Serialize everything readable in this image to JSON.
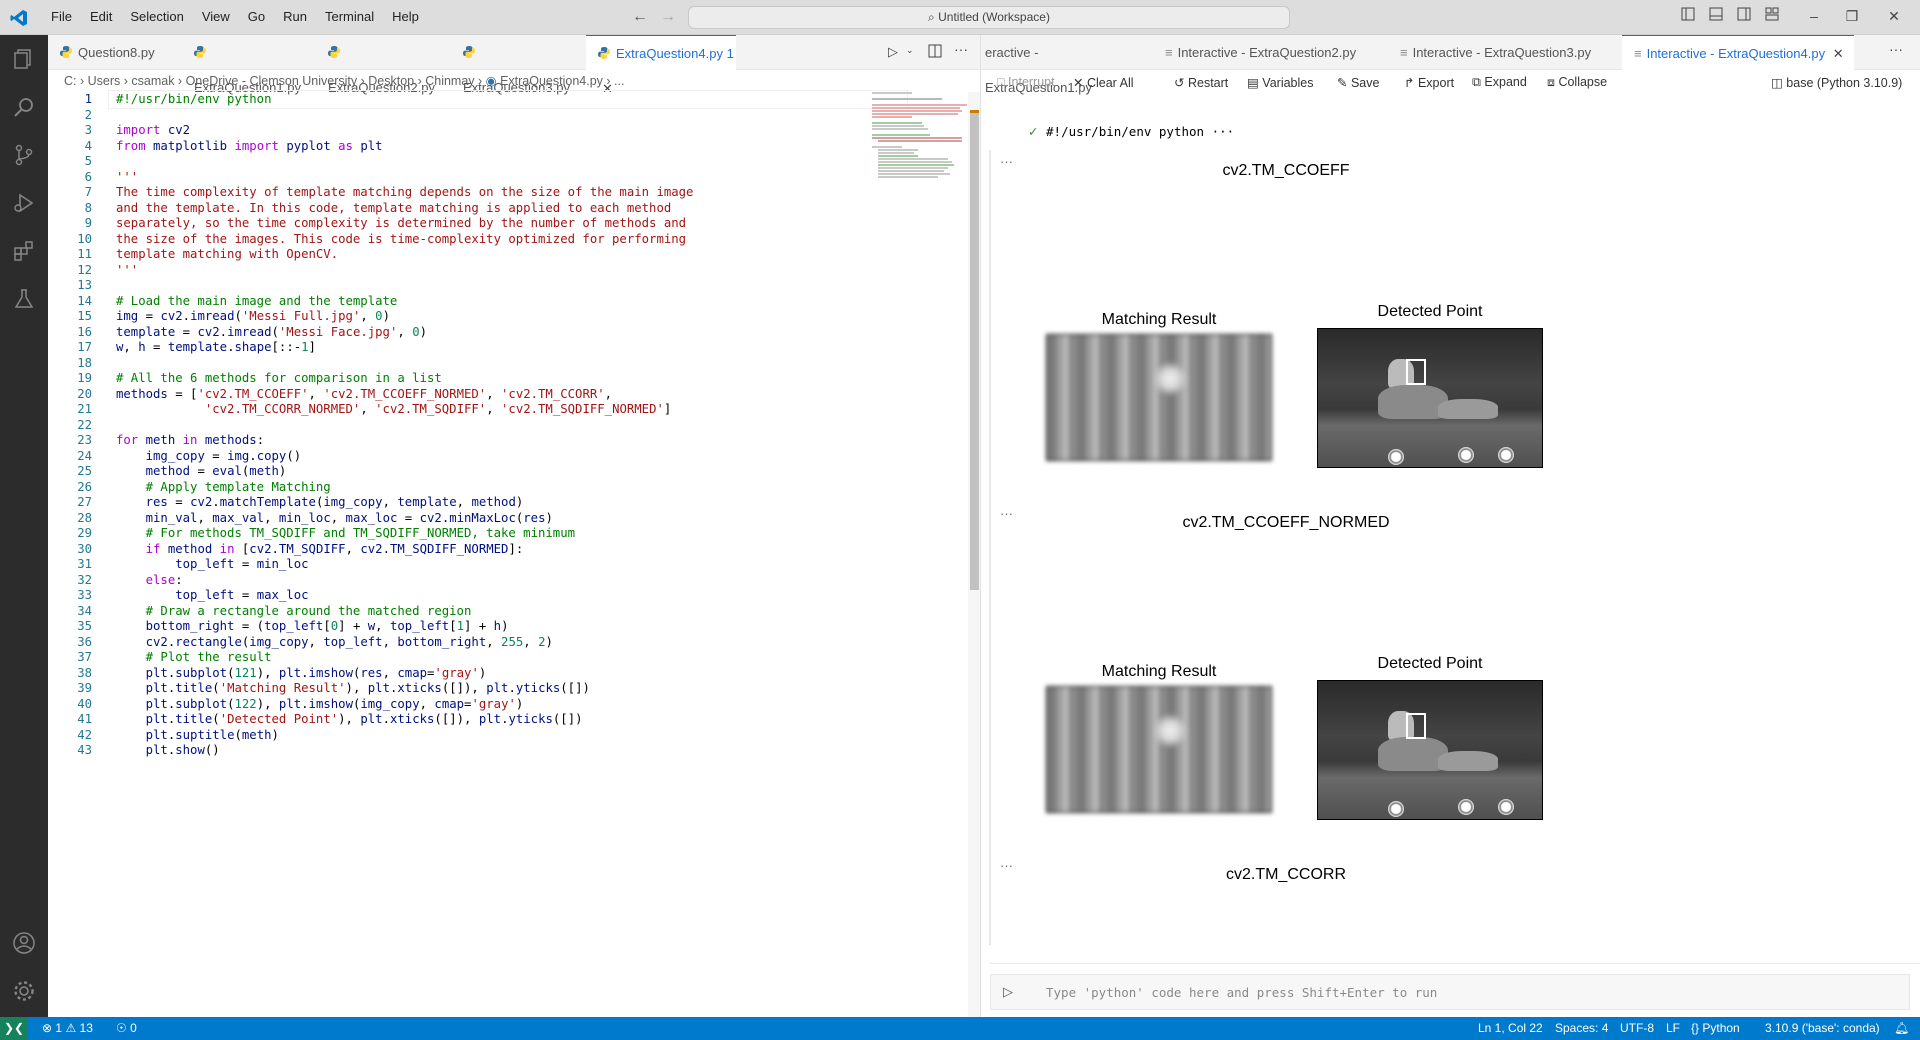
{
  "menu": [
    "File",
    "Edit",
    "Selection",
    "View",
    "Go",
    "Run",
    "Terminal",
    "Help"
  ],
  "search": {
    "label": "Untitled (Workspace)"
  },
  "tabs_left": [
    {
      "label": "Question8.py"
    },
    {
      "label": "ExtraQuestion1.py"
    },
    {
      "label": "ExtraQuestion2.py"
    },
    {
      "label": "ExtraQuestion3.py"
    },
    {
      "label": "ExtraQuestion4.py",
      "badge": "1",
      "active": true
    }
  ],
  "tabs_right": [
    {
      "label": "eractive - ExtraQuestion1.py"
    },
    {
      "label": "Interactive - ExtraQuestion2.py"
    },
    {
      "label": "Interactive - ExtraQuestion3.py"
    },
    {
      "label": "Interactive - ExtraQuestion4.py",
      "active": true
    }
  ],
  "breadcrumb": [
    "C:",
    "Users",
    "csamak",
    "OneDrive - Clemson University",
    "Desktop",
    "Chinmay",
    "ExtraQuestion4.py",
    "..."
  ],
  "code_lines": [
    "#!/usr/bin/env python",
    "",
    "import cv2",
    "from matplotlib import pyplot as plt",
    "",
    "'''",
    "The time complexity of template matching depends on the size of the main image",
    "and the template. In this code, template matching is applied to each method",
    "separately, so the time complexity is determined by the number of methods and",
    "the size of the images. This code is time-complexity optimized for performing",
    "template matching with OpenCV.",
    "'''",
    "",
    "# Load the main image and the template",
    "img = cv2.imread('Messi Full.jpg', 0)",
    "template = cv2.imread('Messi Face.jpg', 0)",
    "w, h = template.shape[::-1]",
    "",
    "# All the 6 methods for comparison in a list",
    "methods = ['cv2.TM_CCOEFF', 'cv2.TM_CCOEFF_NORMED', 'cv2.TM_CCORR',",
    "            'cv2.TM_CCORR_NORMED', 'cv2.TM_SQDIFF', 'cv2.TM_SQDIFF_NORMED']",
    "",
    "for meth in methods:",
    "    img_copy = img.copy()",
    "    method = eval(meth)",
    "    # Apply template Matching",
    "    res = cv2.matchTemplate(img_copy, template, method)",
    "    min_val, max_val, min_loc, max_loc = cv2.minMaxLoc(res)",
    "    # For methods TM_SQDIFF and TM_SQDIFF_NORMED, take minimum",
    "    if method in [cv2.TM_SQDIFF, cv2.TM_SQDIFF_NORMED]:",
    "        top_left = min_loc",
    "    else:",
    "        top_left = max_loc",
    "    # Draw a rectangle around the matched region",
    "    bottom_right = (top_left[0] + w, top_left[1] + h)",
    "    cv2.rectangle(img_copy, top_left, bottom_right, 255, 2)",
    "    # Plot the result",
    "    plt.subplot(121), plt.imshow(res, cmap='gray')",
    "    plt.title('Matching Result'), plt.xticks([]), plt.yticks([])",
    "    plt.subplot(122), plt.imshow(img_copy, cmap='gray')",
    "    plt.title('Detected Point'), plt.xticks([]), plt.yticks([])",
    "    plt.suptitle(meth)",
    "    plt.show()"
  ],
  "toolbar_right": {
    "interrupt": "Interrupt",
    "clear_all": "Clear All",
    "restart": "Restart",
    "variables": "Variables",
    "save": "Save",
    "export": "Export",
    "expand": "Expand",
    "collapse": "Collapse",
    "kernel": "base (Python 3.10.9)"
  },
  "cell_header": "#!/usr/bin/env python ···",
  "outputs": [
    {
      "suptitle": "cv2.TM_CCOEFF",
      "left_title": "Matching Result",
      "right_title": "Detected Point"
    },
    {
      "suptitle": "cv2.TM_CCOEFF_NORMED",
      "left_title": "Matching Result",
      "right_title": "Detected Point"
    },
    {
      "suptitle": "cv2.TM_CCORR"
    }
  ],
  "input": {
    "placeholder": "Type 'python' code here and press Shift+Enter to run"
  },
  "status": {
    "errors": "1",
    "warnings": "13",
    "ports": "0",
    "position": "Ln 1, Col 22",
    "spaces": "Spaces: 4",
    "encoding": "UTF-8",
    "eol": "LF",
    "language": "Python",
    "interpreter": "3.10.9 ('base': conda)"
  },
  "colors": {
    "accent": "#007acc",
    "status_bg": "#007acc",
    "remote": "#16825d",
    "activity_bg": "#2c2c2c"
  }
}
